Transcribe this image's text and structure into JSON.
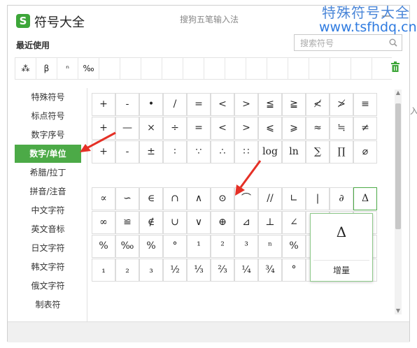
{
  "window": {
    "app_title": "符号大全",
    "ime_title": "搜狗五笔输入法",
    "logo_letter": "S",
    "minimize_glyph": "—"
  },
  "watermark": {
    "line1": "特殊符号大全",
    "line2": "www.tsfhdq.cn"
  },
  "recent": {
    "label": "最近使用",
    "items": [
      "⁂",
      "β",
      "ⁿ",
      "‰",
      "",
      "",
      "",
      "",
      "",
      "",
      "",
      "",
      "",
      "",
      "",
      "",
      ""
    ]
  },
  "search": {
    "placeholder": "搜索符号"
  },
  "sidebar": {
    "items": [
      "特殊符号",
      "标点符号",
      "数字序号",
      "数字/单位",
      "希腊/拉丁",
      "拼音/注音",
      "中文字符",
      "英文音标",
      "日文字符",
      "韩文字符",
      "俄文字符",
      "制表符"
    ],
    "active_index": 3
  },
  "grid_top": [
    [
      "+",
      "-",
      "•",
      "/",
      "=",
      "<",
      ">",
      "≦",
      "≧",
      "≮",
      "≯",
      "≡"
    ],
    [
      "+",
      "—",
      "×",
      "÷",
      "=",
      "<",
      ">",
      "⩽",
      "⩾",
      "≈",
      "≒",
      "≠"
    ],
    [
      "+",
      "-",
      "±",
      "∶",
      "∵",
      "∴",
      "∷",
      "log",
      "ln",
      "∑",
      "∏",
      "⌀"
    ]
  ],
  "grid_bottom": [
    [
      "∝",
      "∽",
      "∈",
      "∩",
      "∧",
      "⊙",
      "⌒",
      "//",
      "∟",
      "|",
      "∂",
      "Δ"
    ],
    [
      "∞",
      "≌",
      "∉",
      "∪",
      "∨",
      "⊕",
      "⊿",
      "⊥",
      "∠",
      "",
      "",
      "∫"
    ],
    [
      "%",
      "‰",
      "%",
      "°",
      "¹",
      "²",
      "³",
      "ⁿ",
      "%",
      "",
      "",
      "∮"
    ],
    [
      "₁",
      "₂",
      "₃",
      "½",
      "⅓",
      "⅔",
      "¼",
      "¾",
      "°",
      "",
      "",
      "="
    ]
  ],
  "popup": {
    "symbol": "Δ",
    "label": "增量"
  },
  "edge_char": "入"
}
